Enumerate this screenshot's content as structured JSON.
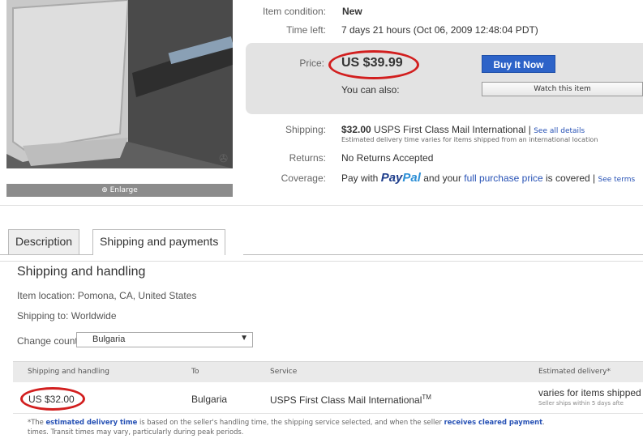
{
  "photo": {
    "enlarge_label": "Enlarge"
  },
  "details": {
    "condition_label": "Item condition:",
    "condition_value": "New",
    "time_left_label": "Time left:",
    "time_left_value": "7 days 21 hours (Oct 06, 2009  12:48:04 PDT)",
    "price_label": "Price:",
    "price_value": "US $39.99",
    "buy_label": "Buy It Now",
    "also_label": "You can also:",
    "watch_label": "Watch this item",
    "shipping_label": "Shipping:",
    "shipping_price": "$32.00",
    "shipping_service": " USPS First Class Mail International | ",
    "shipping_link": "See all details",
    "shipping_note": "Estimated delivery time varies for items shipped from an international location",
    "returns_label": "Returns:",
    "returns_value": "No Returns Accepted",
    "coverage_label": "Coverage:",
    "coverage_pre": "Pay with ",
    "paypal_pay": "Pay",
    "paypal_pal": "Pal",
    "coverage_mid": " and your ",
    "coverage_link": "full purchase price",
    "coverage_post": " is covered | ",
    "coverage_terms": "See terms"
  },
  "tabs": [
    {
      "label": "Description"
    },
    {
      "label": "Shipping and payments"
    }
  ],
  "shipping_section": {
    "title": "Shipping and handling",
    "item_location": "Item location: Pomona, CA, United States",
    "shipping_to": "Shipping to: Worldwide",
    "change_country_label": "Change country:",
    "country_selected": "Bulgaria",
    "columns": [
      "Shipping and handling",
      "To",
      "Service",
      "Estimated delivery*"
    ],
    "row": {
      "cost": "US $32.00",
      "to": "Bulgaria",
      "service": "USPS First Class Mail International",
      "service_tm": "TM",
      "delivery": "varies for items shipped",
      "delivery_note": "Seller ships within 5 days afte"
    },
    "footnote_pre": "*The ",
    "footnote_link1": "estimated delivery time",
    "footnote_mid": " is based on the seller's handling time, the shipping service selected, and when the seller ",
    "footnote_link2": "receives cleared payment",
    "footnote_end": ".",
    "footnote_line2": "times. Transit times may vary, particularly during peak periods."
  },
  "colors": {
    "highlight_oval": "#d21f1f",
    "buy_button": "#2d63c8",
    "link": "#2651b5"
  }
}
